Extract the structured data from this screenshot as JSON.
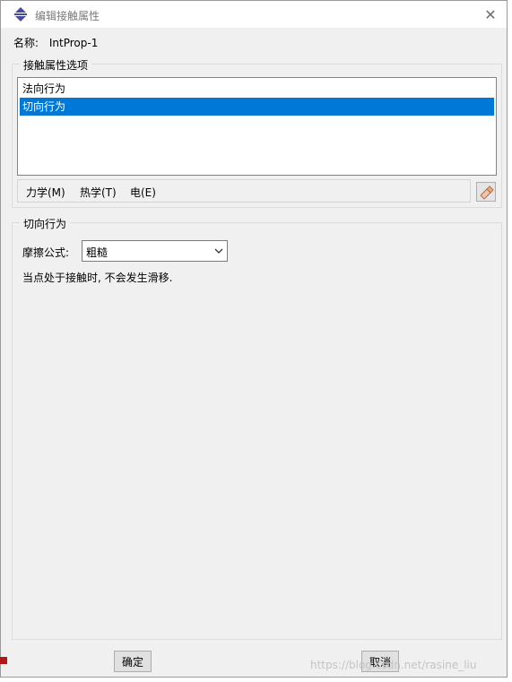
{
  "window": {
    "title": "编辑接触属性"
  },
  "name": {
    "label": "名称:",
    "value": "IntProp-1"
  },
  "options_group": {
    "label": "接触属性选项",
    "items": [
      {
        "label": "法向行为",
        "selected": false
      },
      {
        "label": "切向行为",
        "selected": true
      }
    ],
    "menus": [
      {
        "label": "力学(M)"
      },
      {
        "label": "热学(T)"
      },
      {
        "label": "电(E)"
      }
    ]
  },
  "tangent_group": {
    "label": "切向行为",
    "friction_label": "摩擦公式:",
    "friction_value": "粗糙",
    "note": "当点处于接触时, 不会发生滑移."
  },
  "buttons": {
    "ok": "确定",
    "cancel": "取消"
  },
  "watermark": "https://blog.csdn.net/rasine_liu",
  "colors": {
    "selection": "#0078d7",
    "dialog_bg": "#f0f0f0"
  },
  "icons": [
    "app-icon",
    "close-icon",
    "eraser-icon",
    "chevron-down-icon"
  ]
}
